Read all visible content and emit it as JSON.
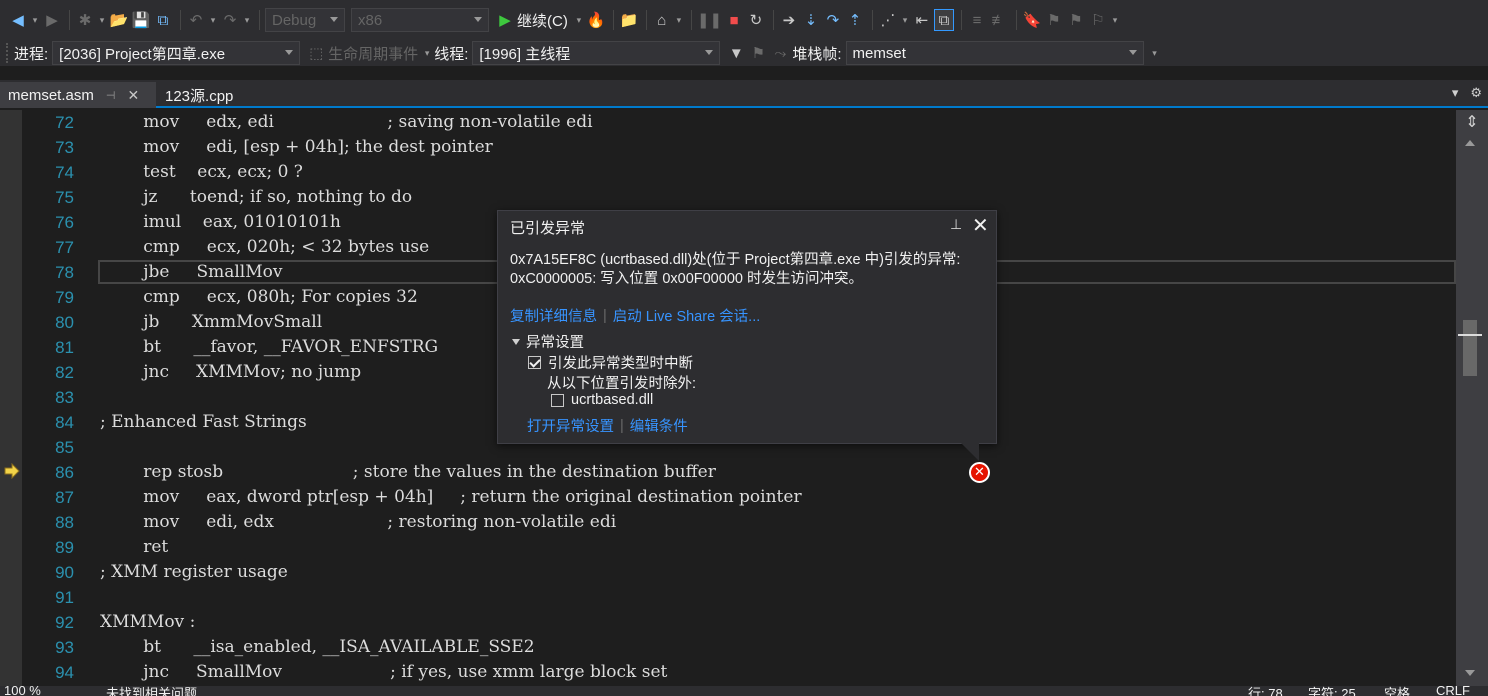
{
  "toolbar": {
    "configuration": "Debug",
    "platform": "x86",
    "continue_label": "继续(C)"
  },
  "debug_location": {
    "process_label": "进程:",
    "process_value": "[2036] Project第四章.exe",
    "lifecycle_label": "生命周期事件",
    "thread_label": "线程:",
    "thread_value": "[1996] 主线程",
    "stackframe_label": "堆栈帧:",
    "stackframe_value": "memset"
  },
  "tabs": [
    {
      "label": "memset.asm",
      "active": true
    },
    {
      "label": "123源.cpp",
      "active": false
    }
  ],
  "editor": {
    "current_line": 78,
    "execution_line": 86,
    "lines": [
      {
        "num": "72",
        "text": "        mov     edx, edi                     ; saving non-volatile edi"
      },
      {
        "num": "73",
        "text": "        mov     edi, [esp + 04h]; the dest pointer"
      },
      {
        "num": "74",
        "text": "        test    ecx, ecx; 0 ?"
      },
      {
        "num": "75",
        "text": "        jz      toend; if so, nothing to do"
      },
      {
        "num": "76",
        "text": "        imul    eax, 01010101h"
      },
      {
        "num": "77",
        "text": "        cmp     ecx, 020h; < 32 bytes use"
      },
      {
        "num": "78",
        "text": "        jbe     SmallMov"
      },
      {
        "num": "79",
        "text": "        cmp     ecx, 080h; For copies 32"
      },
      {
        "num": "80",
        "text": "        jb      XmmMovSmall"
      },
      {
        "num": "81",
        "text": "        bt      __favor, __FAVOR_ENFSTRG"
      },
      {
        "num": "82",
        "text": "        jnc     XMMMov; no jump"
      },
      {
        "num": "83",
        "text": ""
      },
      {
        "num": "84",
        "text": "; Enhanced Fast Strings"
      },
      {
        "num": "85",
        "text": ""
      },
      {
        "num": "86",
        "text": "        rep stosb                        ; store the values in the destination buffer"
      },
      {
        "num": "87",
        "text": "        mov     eax, dword ptr[esp + 04h]     ; return the original destination pointer"
      },
      {
        "num": "88",
        "text": "        mov     edi, edx                     ; restoring non-volatile edi"
      },
      {
        "num": "89",
        "text": "        ret"
      },
      {
        "num": "90",
        "text": "; XMM register usage"
      },
      {
        "num": "91",
        "text": ""
      },
      {
        "num": "92",
        "text": "XMMMov :"
      },
      {
        "num": "93",
        "text": "        bt      __isa_enabled, __ISA_AVAILABLE_SSE2"
      },
      {
        "num": "94",
        "text": "        jnc     SmallMov                    ; if yes, use xmm large block set"
      }
    ]
  },
  "exception_popup": {
    "title": "已引发异常",
    "message": "0x7A15EF8C (ucrtbased.dll)处(位于 Project第四章.exe 中)引发的异常: 0xC0000005: 写入位置 0x00F00000 时发生访问冲突。",
    "copy_details": "复制详细信息",
    "live_share": "启动 Live Share 会话...",
    "settings_header": "异常设置",
    "break_label": "引发此异常类型时中断",
    "break_checked": true,
    "except_label": "从以下位置引发时除外:",
    "module_label": "ucrtbased.dll",
    "module_checked": false,
    "open_settings": "打开异常设置",
    "edit_conditions": "编辑条件"
  },
  "status_bar": {
    "zoom": "100 %",
    "issues": "未找到相关问题",
    "row": "行: 78",
    "col": "字符: 25",
    "tabs": "空格",
    "encoding": "CRLF"
  }
}
